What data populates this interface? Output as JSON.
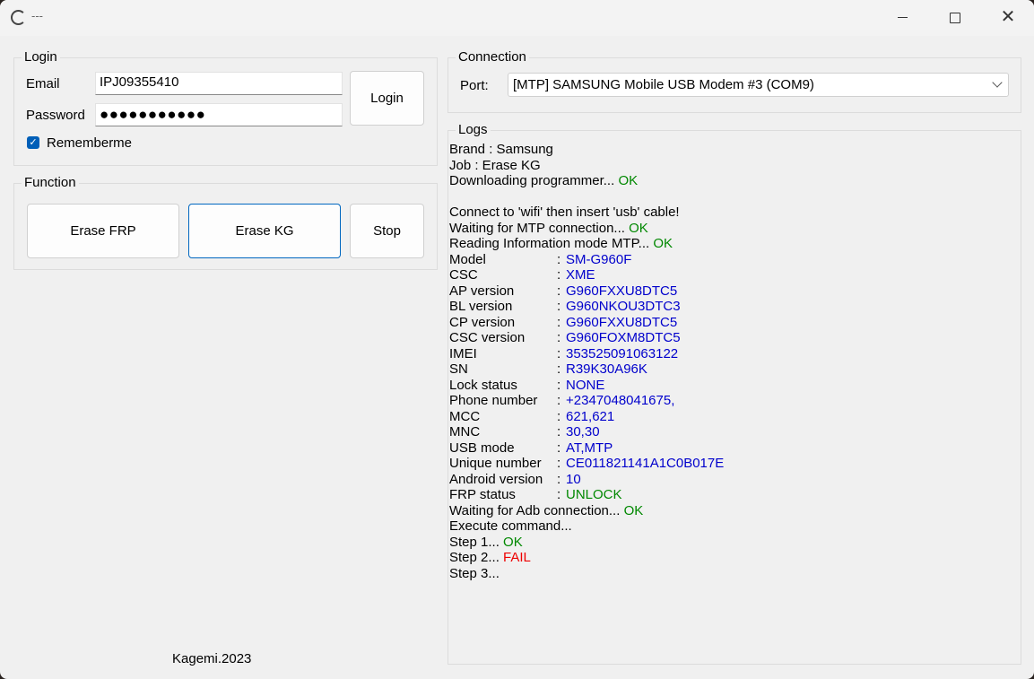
{
  "window": {
    "title": "---",
    "minimize": "–",
    "maximize": "☐",
    "close": "✕"
  },
  "login": {
    "group_title": "Login",
    "email_label": "Email",
    "email_value": "IPJ09355410",
    "password_label": "Password",
    "password_value": "●●●●●●●●●●●",
    "login_button": "Login",
    "remember_checkbox_checked": true,
    "remember_label": "Rememberme"
  },
  "function": {
    "group_title": "Function",
    "erase_frp": "Erase FRP",
    "erase_kg": "Erase KG",
    "stop": "Stop"
  },
  "connection": {
    "group_title": "Connection",
    "port_label": "Port:",
    "port_value": "[MTP] SAMSUNG Mobile USB Modem #3 (COM9)"
  },
  "logs": {
    "group_title": "Logs",
    "lines": [
      {
        "text": "Brand : Samsung"
      },
      {
        "text": "Job : Erase KG"
      },
      {
        "text": "Downloading programmer... ",
        "status": "OK",
        "status_color": "green"
      },
      {
        "text": ""
      },
      {
        "text": "Connect to 'wifi' then insert 'usb' cable!"
      },
      {
        "text": "Waiting for MTP connection... ",
        "status": "OK",
        "status_color": "green"
      },
      {
        "text": "Reading Information mode MTP... ",
        "status": "OK",
        "status_color": "green"
      }
    ],
    "info": [
      {
        "key": "Model",
        "value": "SM-G960F"
      },
      {
        "key": "CSC",
        "value": "XME"
      },
      {
        "key": "AP version",
        "value": "G960FXXU8DTC5"
      },
      {
        "key": "BL version",
        "value": "G960NKOU3DTC3"
      },
      {
        "key": "CP version",
        "value": "G960FXXU8DTC5"
      },
      {
        "key": "CSC version",
        "value": "G960FOXM8DTC5"
      },
      {
        "key": "IMEI",
        "value": "353525091063122"
      },
      {
        "key": "SN",
        "value": "R39K30A96K"
      },
      {
        "key": "Lock status",
        "value": "NONE"
      },
      {
        "key": "Phone number",
        "value": "+2347048041675,"
      },
      {
        "key": "MCC",
        "value": "621,621"
      },
      {
        "key": "MNC",
        "value": "30,30"
      },
      {
        "key": "USB mode",
        "value": "AT,MTP"
      },
      {
        "key": "Unique number",
        "value": "CE011821141A1C0B017E"
      },
      {
        "key": "Android version",
        "value": "10"
      },
      {
        "key": "FRP status",
        "value": "UNLOCK",
        "value_color": "green"
      }
    ],
    "after": [
      {
        "text": "Waiting for Adb connection... ",
        "status": "OK",
        "status_color": "green"
      },
      {
        "text": "Execute command..."
      },
      {
        "text": "Step 1... ",
        "status": "OK",
        "status_color": "green"
      },
      {
        "text": "Step 2... ",
        "status": "FAIL",
        "status_color": "red"
      },
      {
        "text": "Step 3..."
      }
    ]
  },
  "footer": {
    "text": "Kagemi.2023"
  }
}
